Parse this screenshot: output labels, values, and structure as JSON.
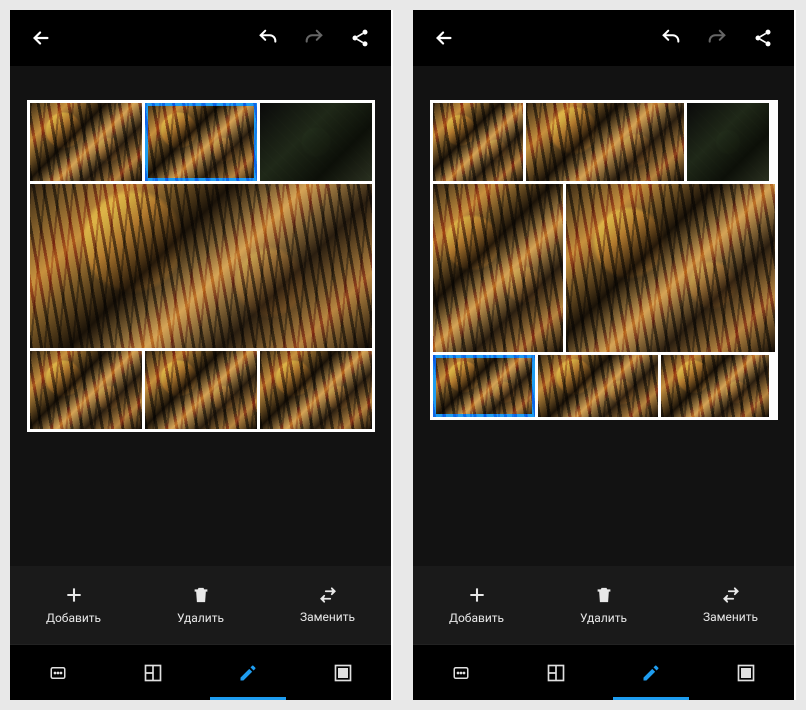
{
  "screens": [
    {
      "toolbar": {
        "back": "back",
        "undo_enabled": true,
        "redo_enabled": false,
        "share": "share"
      },
      "collage": {
        "selected_index": 1,
        "layout": "3-1-3"
      },
      "actions": {
        "add": "Добавить",
        "delete": "Удалить",
        "replace": "Заменить"
      },
      "tabs": {
        "active": 2,
        "items": [
          "aspect",
          "layout",
          "edit",
          "border"
        ]
      }
    },
    {
      "toolbar": {
        "back": "back",
        "undo_enabled": true,
        "redo_enabled": false,
        "share": "share"
      },
      "collage": {
        "selected_index": 5,
        "layout": "3-2-3"
      },
      "actions": {
        "add": "Добавить",
        "delete": "Удалить",
        "replace": "Заменить"
      },
      "tabs": {
        "active": 2,
        "items": [
          "aspect",
          "layout",
          "edit",
          "border"
        ]
      }
    }
  ]
}
